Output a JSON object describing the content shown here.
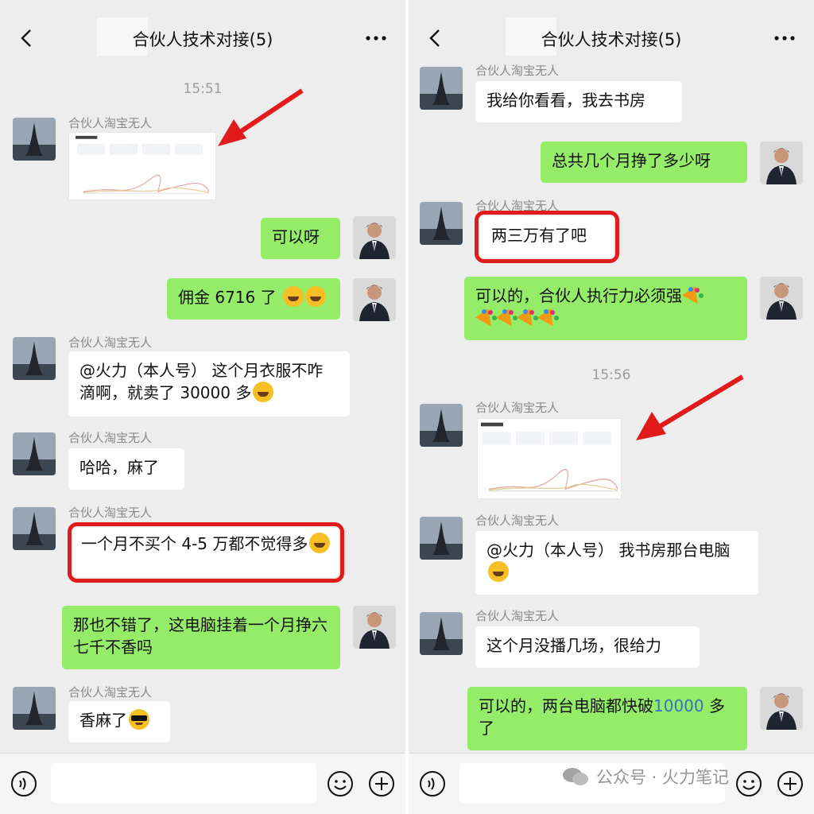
{
  "chat": {
    "title": "合伙人技术对接(5)",
    "sender_name": "合伙人淘宝无人"
  },
  "left": {
    "time1": "15:51",
    "m_keyi": "可以呀",
    "m_yongjin": "佣金 6716 了",
    "m_huoli1": "@火力（本人号） 这个月衣服不咋滴啊，就卖了 30000 多",
    "m_haha": "哈哈，麻了",
    "m_yige": "一个月不买个 4-5 万都不觉得多",
    "m_nayebucuo": "那也不错了，这电脑挂着一个月挣六七千不香吗",
    "m_xiangma": "香麻了"
  },
  "right": {
    "m_wogeini": "我给你看看，我去书房",
    "m_zonggong": "总共几个月挣了多少呀",
    "m_liangsan": "两三万有了吧",
    "m_keyide": "可以的，合伙人执行力必须强",
    "time2": "15:56",
    "m_huoli2": "@火力（本人号） 我书房那台电脑",
    "m_zhege": "这个月没播几场，很给力",
    "m_liangtai_pre": "可以的，两台电脑都快破",
    "m_liangtai_num": "10000",
    "m_liangtai_post": "多了"
  },
  "watermark": "公众号 · 火力笔记",
  "icons": {
    "back": "chevron-left-icon",
    "more": "more-dots-icon",
    "voice": "voice-icon",
    "emoji": "emoji-icon",
    "plus": "plus-icon"
  },
  "colors": {
    "bubble_out": "#95ec69",
    "bubble_in": "#ffffff",
    "background": "#ededed",
    "highlight": "#e11b1b"
  }
}
